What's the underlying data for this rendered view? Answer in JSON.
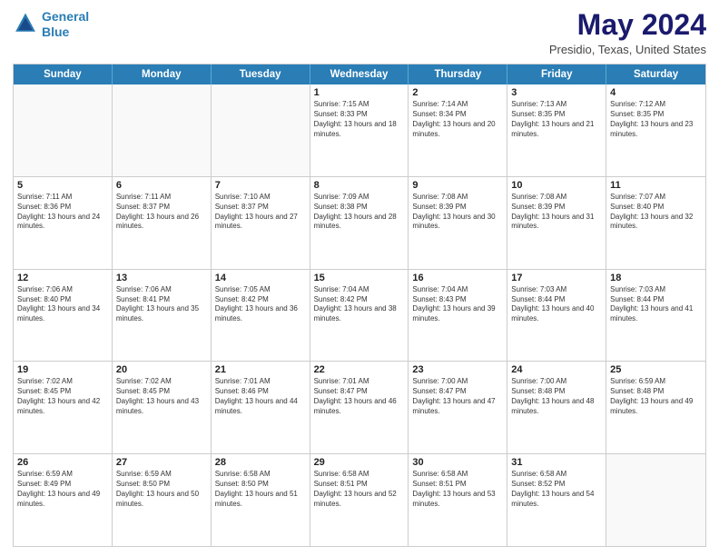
{
  "header": {
    "logo_line1": "General",
    "logo_line2": "Blue",
    "main_title": "May 2024",
    "subtitle": "Presidio, Texas, United States"
  },
  "calendar": {
    "days_of_week": [
      "Sunday",
      "Monday",
      "Tuesday",
      "Wednesday",
      "Thursday",
      "Friday",
      "Saturday"
    ],
    "weeks": [
      [
        {
          "day": "",
          "empty": true
        },
        {
          "day": "",
          "empty": true
        },
        {
          "day": "",
          "empty": true
        },
        {
          "day": "1",
          "sunrise": "7:15 AM",
          "sunset": "8:33 PM",
          "daylight": "13 hours and 18 minutes."
        },
        {
          "day": "2",
          "sunrise": "7:14 AM",
          "sunset": "8:34 PM",
          "daylight": "13 hours and 20 minutes."
        },
        {
          "day": "3",
          "sunrise": "7:13 AM",
          "sunset": "8:35 PM",
          "daylight": "13 hours and 21 minutes."
        },
        {
          "day": "4",
          "sunrise": "7:12 AM",
          "sunset": "8:35 PM",
          "daylight": "13 hours and 23 minutes."
        }
      ],
      [
        {
          "day": "5",
          "sunrise": "7:11 AM",
          "sunset": "8:36 PM",
          "daylight": "13 hours and 24 minutes."
        },
        {
          "day": "6",
          "sunrise": "7:11 AM",
          "sunset": "8:37 PM",
          "daylight": "13 hours and 26 minutes."
        },
        {
          "day": "7",
          "sunrise": "7:10 AM",
          "sunset": "8:37 PM",
          "daylight": "13 hours and 27 minutes."
        },
        {
          "day": "8",
          "sunrise": "7:09 AM",
          "sunset": "8:38 PM",
          "daylight": "13 hours and 28 minutes."
        },
        {
          "day": "9",
          "sunrise": "7:08 AM",
          "sunset": "8:39 PM",
          "daylight": "13 hours and 30 minutes."
        },
        {
          "day": "10",
          "sunrise": "7:08 AM",
          "sunset": "8:39 PM",
          "daylight": "13 hours and 31 minutes."
        },
        {
          "day": "11",
          "sunrise": "7:07 AM",
          "sunset": "8:40 PM",
          "daylight": "13 hours and 32 minutes."
        }
      ],
      [
        {
          "day": "12",
          "sunrise": "7:06 AM",
          "sunset": "8:40 PM",
          "daylight": "13 hours and 34 minutes."
        },
        {
          "day": "13",
          "sunrise": "7:06 AM",
          "sunset": "8:41 PM",
          "daylight": "13 hours and 35 minutes."
        },
        {
          "day": "14",
          "sunrise": "7:05 AM",
          "sunset": "8:42 PM",
          "daylight": "13 hours and 36 minutes."
        },
        {
          "day": "15",
          "sunrise": "7:04 AM",
          "sunset": "8:42 PM",
          "daylight": "13 hours and 38 minutes."
        },
        {
          "day": "16",
          "sunrise": "7:04 AM",
          "sunset": "8:43 PM",
          "daylight": "13 hours and 39 minutes."
        },
        {
          "day": "17",
          "sunrise": "7:03 AM",
          "sunset": "8:44 PM",
          "daylight": "13 hours and 40 minutes."
        },
        {
          "day": "18",
          "sunrise": "7:03 AM",
          "sunset": "8:44 PM",
          "daylight": "13 hours and 41 minutes."
        }
      ],
      [
        {
          "day": "19",
          "sunrise": "7:02 AM",
          "sunset": "8:45 PM",
          "daylight": "13 hours and 42 minutes."
        },
        {
          "day": "20",
          "sunrise": "7:02 AM",
          "sunset": "8:45 PM",
          "daylight": "13 hours and 43 minutes."
        },
        {
          "day": "21",
          "sunrise": "7:01 AM",
          "sunset": "8:46 PM",
          "daylight": "13 hours and 44 minutes."
        },
        {
          "day": "22",
          "sunrise": "7:01 AM",
          "sunset": "8:47 PM",
          "daylight": "13 hours and 46 minutes."
        },
        {
          "day": "23",
          "sunrise": "7:00 AM",
          "sunset": "8:47 PM",
          "daylight": "13 hours and 47 minutes."
        },
        {
          "day": "24",
          "sunrise": "7:00 AM",
          "sunset": "8:48 PM",
          "daylight": "13 hours and 48 minutes."
        },
        {
          "day": "25",
          "sunrise": "6:59 AM",
          "sunset": "8:48 PM",
          "daylight": "13 hours and 49 minutes."
        }
      ],
      [
        {
          "day": "26",
          "sunrise": "6:59 AM",
          "sunset": "8:49 PM",
          "daylight": "13 hours and 49 minutes."
        },
        {
          "day": "27",
          "sunrise": "6:59 AM",
          "sunset": "8:50 PM",
          "daylight": "13 hours and 50 minutes."
        },
        {
          "day": "28",
          "sunrise": "6:58 AM",
          "sunset": "8:50 PM",
          "daylight": "13 hours and 51 minutes."
        },
        {
          "day": "29",
          "sunrise": "6:58 AM",
          "sunset": "8:51 PM",
          "daylight": "13 hours and 52 minutes."
        },
        {
          "day": "30",
          "sunrise": "6:58 AM",
          "sunset": "8:51 PM",
          "daylight": "13 hours and 53 minutes."
        },
        {
          "day": "31",
          "sunrise": "6:58 AM",
          "sunset": "8:52 PM",
          "daylight": "13 hours and 54 minutes."
        },
        {
          "day": "",
          "empty": true
        }
      ]
    ]
  }
}
